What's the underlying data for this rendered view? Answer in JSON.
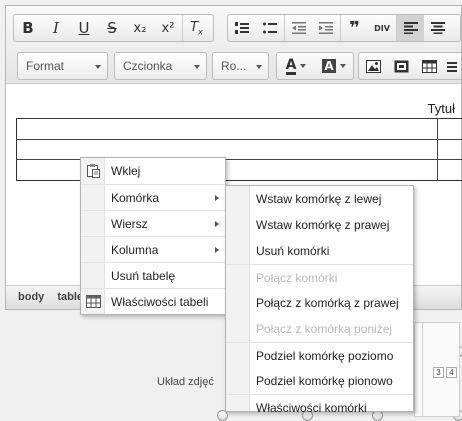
{
  "toolbar": {
    "row1": [
      {
        "name": "bold-button",
        "glyph": "B"
      },
      {
        "name": "italic-button",
        "glyph": "I"
      },
      {
        "name": "underline-button",
        "glyph": "U"
      },
      {
        "name": "strikethrough-button",
        "glyph": "S"
      },
      {
        "name": "subscript-button",
        "glyph": "x₂"
      },
      {
        "name": "superscript-button",
        "glyph": "x²"
      },
      {
        "name": "remove-format-button",
        "glyph": "Tx"
      },
      {
        "name": "numbered-list-button",
        "glyph": "ordered-list-icon"
      },
      {
        "name": "bulleted-list-button",
        "glyph": "bulleted-list-icon"
      },
      {
        "name": "outdent-button",
        "glyph": "outdent-icon"
      },
      {
        "name": "indent-button",
        "glyph": "indent-icon"
      },
      {
        "name": "blockquote-button",
        "glyph": "❞"
      },
      {
        "name": "div-button",
        "glyph": "DIV"
      },
      {
        "name": "align-left-button",
        "glyph": "align-left-icon"
      },
      {
        "name": "align-center-button",
        "glyph": "align-center-icon"
      }
    ],
    "format_label": "Format",
    "font_label": "Czcionka",
    "size_label": "Ro...",
    "text_color_glyph": "A",
    "bg_color_glyph": "A"
  },
  "content": {
    "table_caption": "Tytuł"
  },
  "statusbar": {
    "path": [
      "body",
      "table"
    ]
  },
  "lower": {
    "layout_label": "Układ zdjęć",
    "mini_labels": [
      "3",
      "4",
      "3",
      "4"
    ]
  },
  "context_menu": {
    "items": [
      {
        "label": "Wklej",
        "icon": "paste-icon",
        "submenu": false
      },
      {
        "label": "Komórka",
        "submenu": true
      },
      {
        "label": "Wiersz",
        "submenu": true
      },
      {
        "label": "Kolumna",
        "submenu": true
      },
      {
        "label": "Usuń tabelę",
        "submenu": false
      },
      {
        "label": "Właściwości tabeli",
        "icon": "table-icon",
        "submenu": false
      }
    ]
  },
  "cell_menu": {
    "items": [
      {
        "label": "Wstaw komórkę z lewej",
        "disabled": false
      },
      {
        "label": "Wstaw komórkę z prawej",
        "disabled": false
      },
      {
        "label": "Usuń komórki",
        "disabled": false
      },
      {
        "label": "Połącz komórki",
        "disabled": true
      },
      {
        "label": "Połącz z komórką z prawej",
        "disabled": false
      },
      {
        "label": "Połącz z komórką poniżej",
        "disabled": true
      },
      {
        "label": "Podziel komórkę poziomo",
        "disabled": false
      },
      {
        "label": "Podziel komórkę pionowo",
        "disabled": false
      },
      {
        "label": "Właściwości komórki",
        "disabled": false
      }
    ]
  }
}
